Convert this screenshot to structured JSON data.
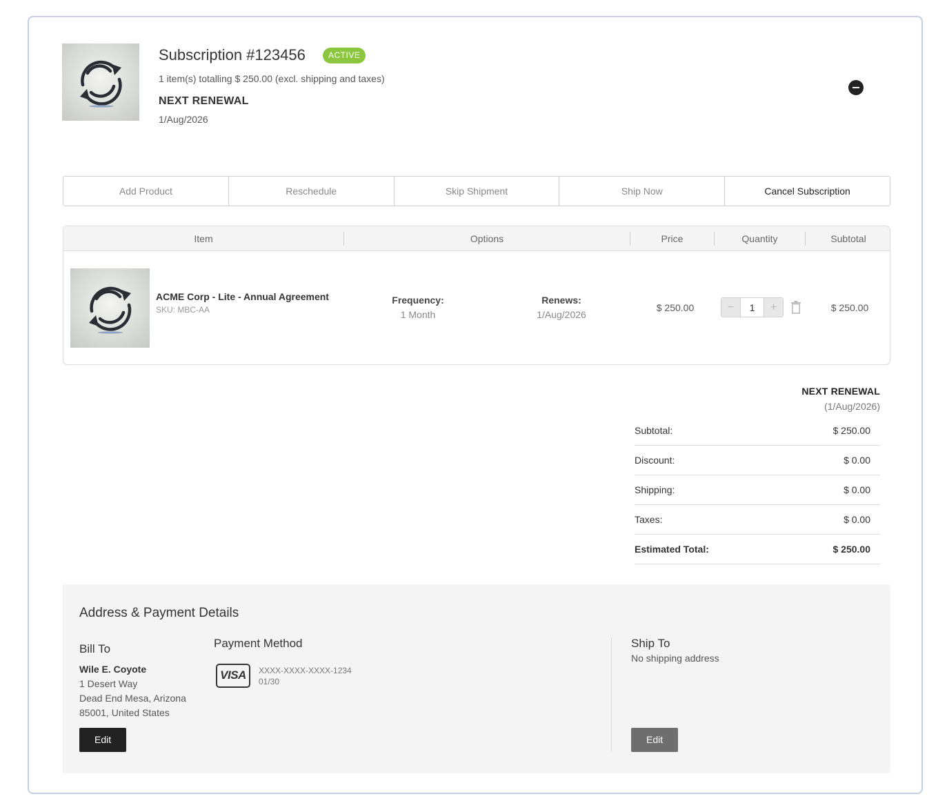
{
  "header": {
    "title": "Subscription #123456",
    "status": "ACTIVE",
    "summary": "1 item(s) totalling $ 250.00 (excl. shipping and taxes)",
    "renewal_label": "NEXT RENEWAL",
    "renewal_date": "1/Aug/2026",
    "image_icon": "refresh-cycle-icon",
    "collapse_icon": "minus-circle-icon"
  },
  "actions": [
    "Add Product",
    "Reschedule",
    "Skip Shipment",
    "Ship Now",
    "Cancel Subscription"
  ],
  "table": {
    "columns": [
      "Item",
      "Options",
      "Price",
      "Quantity",
      "Subtotal"
    ],
    "rows": [
      {
        "name": "ACME Corp - Lite - Annual Agreement",
        "sku": "SKU: MBC-AA",
        "frequency_label": "Frequency:",
        "frequency_value": "1 Month",
        "renews_label": "Renews:",
        "renews_value": "1/Aug/2026",
        "price": "$ 250.00",
        "quantity": "1",
        "subtotal": "$ 250.00"
      }
    ]
  },
  "totals": {
    "renewal_label": "NEXT RENEWAL",
    "renewal_date": "(1/Aug/2026)",
    "rows": [
      {
        "label": "Subtotal:",
        "value": "$ 250.00"
      },
      {
        "label": "Discount:",
        "value": "$ 0.00"
      },
      {
        "label": "Shipping:",
        "value": "$ 0.00"
      },
      {
        "label": "Taxes:",
        "value": "$ 0.00"
      },
      {
        "label": "Estimated Total:",
        "value": "$ 250.00"
      }
    ]
  },
  "address": {
    "title": "Address & Payment Details",
    "bill_to": {
      "title": "Bill To",
      "name": "Wile E. Coyote",
      "lines": [
        "1 Desert Way",
        "Dead End Mesa, Arizona",
        "85001, United States"
      ],
      "edit_label": "Edit"
    },
    "payment": {
      "title": "Payment Method",
      "brand": "VISA",
      "card_number": "XXXX-XXXX-XXXX-1234",
      "expiry": "01/30"
    },
    "ship_to": {
      "title": "Ship To",
      "empty_text": "No shipping address",
      "edit_label": "Edit"
    }
  },
  "colors": {
    "active_badge": "#8cc63e",
    "card_border": "#c3d0e6",
    "bill_edit_button": "#222222",
    "ship_edit_button": "#6e6e6e",
    "panel_background": "#f4f4f4"
  }
}
